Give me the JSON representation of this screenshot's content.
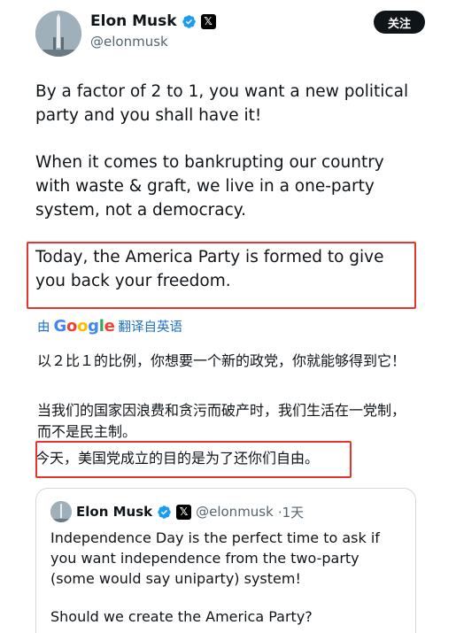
{
  "author": {
    "name": "Elon Musk",
    "handle": "@elonmusk",
    "x_badge": "𝕏"
  },
  "follow_label": "关注",
  "tweet": {
    "paragraph1": "By a factor of 2 to 1, you want a new political party and you shall have it!",
    "paragraph2": "When it comes to bankrupting our country with waste & graft, we live in a one-party system, not a democracy.",
    "paragraph3": "Today, the America Party is formed to give you back your freedom."
  },
  "translation": {
    "prefix": "由",
    "provider": "Google",
    "action": "翻译自英语",
    "line1": "以２比１的比例，你想要一个新的政党，你就能够得到它！",
    "line2": "当我们的国家因浪费和贪污而破产时，我们生活在一党制，而不是民主制。",
    "line3": "今天，美国党成立的目的是为了还你们自由。"
  },
  "quote": {
    "name": "Elon Musk",
    "handle": "@elonmusk",
    "time": "·1天",
    "text1": "Independence Day is the perfect time to ask if you want independence from the two-party (some would say uniparty) system!",
    "text2": "Should we create the America Party?"
  },
  "colors": {
    "highlight": "#e8332f",
    "verified": "#1d9bf0",
    "link": "#1d6fc9"
  }
}
